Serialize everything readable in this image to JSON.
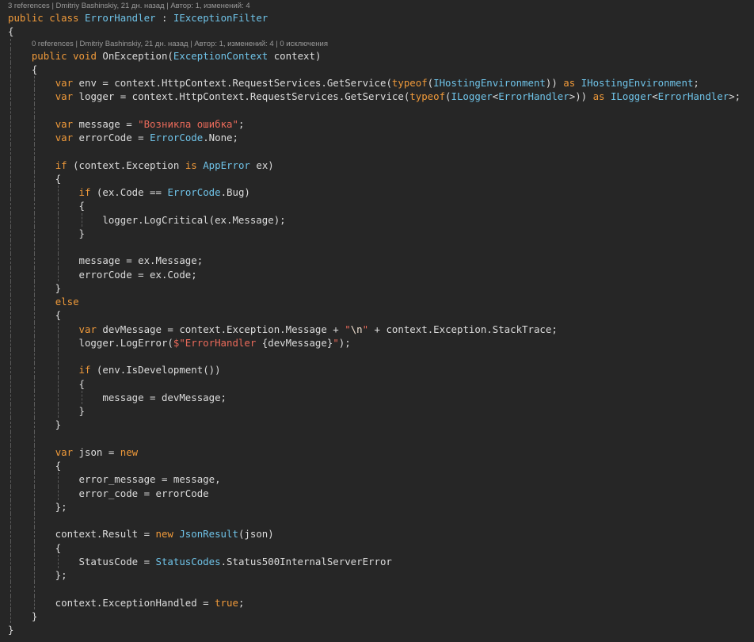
{
  "lines": [
    {
      "lens": "3 references | Dmitriy Bashinskiy, 21 дн. назад | Автор: 1, изменений: 4",
      "indent": 0
    },
    {
      "t": [
        [
          "kw",
          "public class "
        ],
        [
          "ty",
          "ErrorHandler"
        ],
        [
          "tx",
          " : "
        ],
        [
          "ty",
          "IExceptionFilter"
        ]
      ]
    },
    {
      "t": [
        [
          "tx",
          "{"
        ]
      ]
    },
    {
      "lens": "0 references | Dmitriy Bashinskiy, 21 дн. назад | Автор: 1, изменений: 4 | 0 исключения",
      "indent": 1
    },
    {
      "t": [
        [
          "tx",
          "    "
        ],
        [
          "kw",
          "public void "
        ],
        [
          "tx",
          "OnException("
        ],
        [
          "ty",
          "ExceptionContext"
        ],
        [
          "tx",
          " context)"
        ]
      ]
    },
    {
      "t": [
        [
          "tx",
          "    {"
        ]
      ]
    },
    {
      "t": [
        [
          "tx",
          "        "
        ],
        [
          "kw",
          "var "
        ],
        [
          "tx",
          "env = context.HttpContext.RequestServices.GetService("
        ],
        [
          "kw",
          "typeof"
        ],
        [
          "tx",
          "("
        ],
        [
          "ty",
          "IHostingEnvironment"
        ],
        [
          "tx",
          ")) "
        ],
        [
          "kw",
          "as "
        ],
        [
          "ty",
          "IHostingEnvironment"
        ],
        [
          "tx",
          ";"
        ]
      ]
    },
    {
      "t": [
        [
          "tx",
          "        "
        ],
        [
          "kw",
          "var "
        ],
        [
          "tx",
          "logger = context.HttpContext.RequestServices.GetService("
        ],
        [
          "kw",
          "typeof"
        ],
        [
          "tx",
          "("
        ],
        [
          "ty",
          "ILogger"
        ],
        [
          "tx",
          "<"
        ],
        [
          "ty",
          "ErrorHandler"
        ],
        [
          "tx",
          ">)) "
        ],
        [
          "kw",
          "as "
        ],
        [
          "ty",
          "ILogger"
        ],
        [
          "tx",
          "<"
        ],
        [
          "ty",
          "ErrorHandler"
        ],
        [
          "tx",
          ">;"
        ]
      ]
    },
    {
      "t": []
    },
    {
      "t": [
        [
          "tx",
          "        "
        ],
        [
          "kw",
          "var "
        ],
        [
          "tx",
          "message = "
        ],
        [
          "st",
          "\"Возникла ошибка\""
        ],
        [
          "tx",
          ";"
        ]
      ]
    },
    {
      "t": [
        [
          "tx",
          "        "
        ],
        [
          "kw",
          "var "
        ],
        [
          "tx",
          "errorCode = "
        ],
        [
          "ty",
          "ErrorCode"
        ],
        [
          "tx",
          ".None;"
        ]
      ]
    },
    {
      "t": []
    },
    {
      "t": [
        [
          "tx",
          "        "
        ],
        [
          "kw",
          "if "
        ],
        [
          "tx",
          "(context.Exception "
        ],
        [
          "kw",
          "is "
        ],
        [
          "ty",
          "AppError"
        ],
        [
          "tx",
          " ex)"
        ]
      ]
    },
    {
      "t": [
        [
          "tx",
          "        {"
        ]
      ]
    },
    {
      "t": [
        [
          "tx",
          "            "
        ],
        [
          "kw",
          "if "
        ],
        [
          "tx",
          "(ex.Code == "
        ],
        [
          "ty",
          "ErrorCode"
        ],
        [
          "tx",
          ".Bug)"
        ]
      ]
    },
    {
      "t": [
        [
          "tx",
          "            {"
        ]
      ]
    },
    {
      "t": [
        [
          "tx",
          "                logger.LogCritical(ex.Message);"
        ]
      ]
    },
    {
      "t": [
        [
          "tx",
          "            }"
        ]
      ]
    },
    {
      "t": []
    },
    {
      "t": [
        [
          "tx",
          "            message = ex.Message;"
        ]
      ]
    },
    {
      "t": [
        [
          "tx",
          "            errorCode = ex.Code;"
        ]
      ]
    },
    {
      "t": [
        [
          "tx",
          "        }"
        ]
      ]
    },
    {
      "t": [
        [
          "tx",
          "        "
        ],
        [
          "kw",
          "else"
        ]
      ]
    },
    {
      "t": [
        [
          "tx",
          "        {"
        ]
      ]
    },
    {
      "t": [
        [
          "tx",
          "            "
        ],
        [
          "kw",
          "var "
        ],
        [
          "tx",
          "devMessage = context.Exception.Message + "
        ],
        [
          "st",
          "\""
        ],
        [
          "esc",
          "\\n"
        ],
        [
          "st",
          "\""
        ],
        [
          "tx",
          " + context.Exception.StackTrace;"
        ]
      ]
    },
    {
      "t": [
        [
          "tx",
          "            logger.LogError("
        ],
        [
          "st",
          "$\"ErrorHandler "
        ],
        [
          "tx",
          "{devMessage}"
        ],
        [
          "st",
          "\""
        ],
        [
          "tx",
          ");"
        ]
      ]
    },
    {
      "t": []
    },
    {
      "t": [
        [
          "tx",
          "            "
        ],
        [
          "kw",
          "if "
        ],
        [
          "tx",
          "(env.IsDevelopment())"
        ]
      ]
    },
    {
      "t": [
        [
          "tx",
          "            {"
        ]
      ]
    },
    {
      "t": [
        [
          "tx",
          "                message = devMessage;"
        ]
      ]
    },
    {
      "t": [
        [
          "tx",
          "            }"
        ]
      ]
    },
    {
      "t": [
        [
          "tx",
          "        }"
        ]
      ]
    },
    {
      "t": []
    },
    {
      "t": [
        [
          "tx",
          "        "
        ],
        [
          "kw",
          "var "
        ],
        [
          "tx",
          "json = "
        ],
        [
          "kw",
          "new"
        ]
      ]
    },
    {
      "t": [
        [
          "tx",
          "        {"
        ]
      ]
    },
    {
      "t": [
        [
          "tx",
          "            error_message = message,"
        ]
      ]
    },
    {
      "t": [
        [
          "tx",
          "            error_code = errorCode"
        ]
      ]
    },
    {
      "t": [
        [
          "tx",
          "        };"
        ]
      ]
    },
    {
      "t": []
    },
    {
      "t": [
        [
          "tx",
          "        context.Result = "
        ],
        [
          "kw",
          "new "
        ],
        [
          "ty",
          "JsonResult"
        ],
        [
          "tx",
          "(json)"
        ]
      ]
    },
    {
      "t": [
        [
          "tx",
          "        {"
        ]
      ]
    },
    {
      "t": [
        [
          "tx",
          "            StatusCode = "
        ],
        [
          "ty",
          "StatusCodes"
        ],
        [
          "tx",
          ".Status500InternalServerError"
        ]
      ]
    },
    {
      "t": [
        [
          "tx",
          "        };"
        ]
      ]
    },
    {
      "t": []
    },
    {
      "t": [
        [
          "tx",
          "        context.ExceptionHandled = "
        ],
        [
          "kw",
          "true"
        ],
        [
          "tx",
          ";"
        ]
      ]
    },
    {
      "t": [
        [
          "tx",
          "    }"
        ]
      ]
    },
    {
      "t": [
        [
          "tx",
          "}"
        ]
      ]
    }
  ]
}
